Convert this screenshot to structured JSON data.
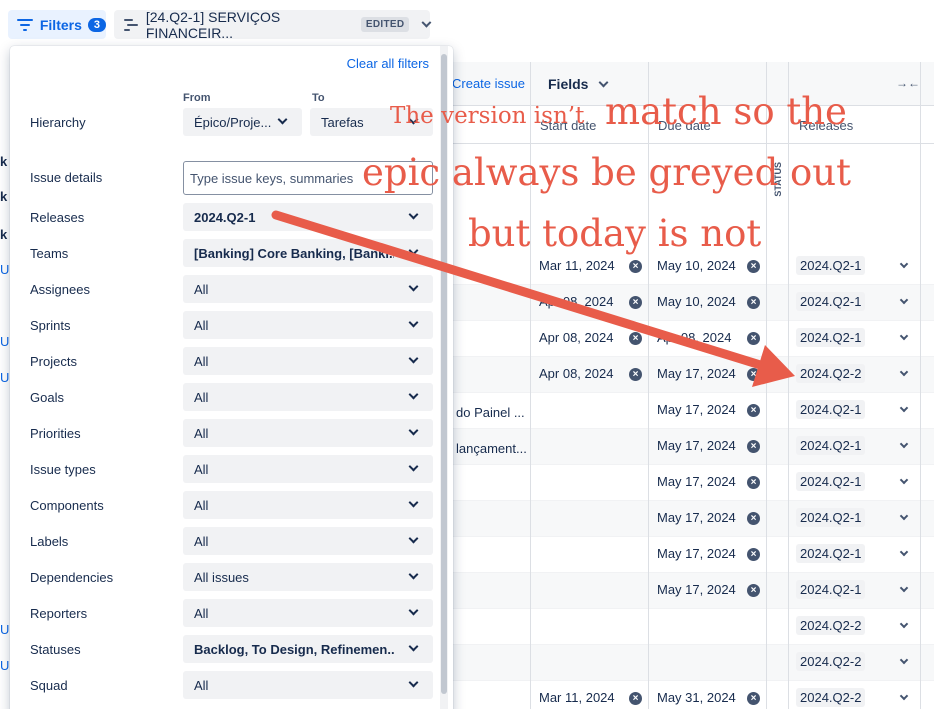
{
  "toolbar": {
    "filters_label": "Filters",
    "filters_count": "3",
    "plan_name": "[24.Q2-1] SERVIÇOS FINANCEIR...",
    "edited_badge": "EDITED"
  },
  "grid": {
    "create_issue": "Create issue",
    "fields_label": "Fields",
    "collapse_icon": "collapse-arrows-icon",
    "columns": {
      "start_date": "Start date",
      "due_date": "Due date",
      "releases": "Releases",
      "status": "STATUS"
    },
    "partial_summaries": [
      "do Painel ...",
      "lançament..."
    ],
    "left_fragments": [
      "k",
      "k",
      "k",
      "U",
      "U",
      "U",
      "U",
      "U"
    ],
    "rows": [
      {
        "start": "Mar 11, 2024",
        "due": "May 10, 2024",
        "release": "2024.Q2-1"
      },
      {
        "start": "Apr 08, 2024",
        "due": "May 10, 2024",
        "release": "2024.Q2-1"
      },
      {
        "start": "Apr 08, 2024",
        "due": "Apr 08, 2024",
        "release": "2024.Q2-1"
      },
      {
        "start": "Apr 08, 2024",
        "due": "May 17, 2024",
        "release": "2024.Q2-2"
      },
      {
        "start": "",
        "due": "May 17, 2024",
        "release": "2024.Q2-1"
      },
      {
        "start": "",
        "due": "May 17, 2024",
        "release": "2024.Q2-1"
      },
      {
        "start": "",
        "due": "May 17, 2024",
        "release": "2024.Q2-1"
      },
      {
        "start": "",
        "due": "May 17, 2024",
        "release": "2024.Q2-1"
      },
      {
        "start": "",
        "due": "May 17, 2024",
        "release": "2024.Q2-1"
      },
      {
        "start": "",
        "due": "May 17, 2024",
        "release": "2024.Q2-1"
      },
      {
        "start": "",
        "due": "",
        "release": "2024.Q2-2"
      },
      {
        "start": "",
        "due": "",
        "release": "2024.Q2-2"
      },
      {
        "start": "Mar 11, 2024",
        "due": "May 31, 2024",
        "release": "2024.Q2-2"
      }
    ]
  },
  "filter_panel": {
    "clear_all": "Clear all filters",
    "from_label": "From",
    "to_label": "To",
    "hierarchy": {
      "label": "Hierarchy",
      "from_value": "Épico/Proje...",
      "to_value": "Tarefas"
    },
    "issue_details": {
      "label": "Issue details",
      "placeholder": "Type issue keys, summaries"
    },
    "filters": [
      {
        "label": "Releases",
        "value": "2024.Q2-1"
      },
      {
        "label": "Teams",
        "value": "[Banking] Core Banking, [Banki..."
      },
      {
        "label": "Assignees",
        "value": "All"
      },
      {
        "label": "Sprints",
        "value": "All"
      },
      {
        "label": "Projects",
        "value": "All"
      },
      {
        "label": "Goals",
        "value": "All"
      },
      {
        "label": "Priorities",
        "value": "All"
      },
      {
        "label": "Issue types",
        "value": "All"
      },
      {
        "label": "Components",
        "value": "All"
      },
      {
        "label": "Labels",
        "value": "All"
      },
      {
        "label": "Dependencies",
        "value": "All issues"
      },
      {
        "label": "Reporters",
        "value": "All"
      },
      {
        "label": "Statuses",
        "value": "Backlog, To Design, Refinemen..."
      },
      {
        "label": "Squad",
        "value": "All"
      }
    ]
  },
  "annotation": {
    "line1a": "The version isn’t ",
    "line1b": "match so the",
    "line2": "epic always be greyed out",
    "line3": "but today is not",
    "color": "#e85c4a"
  }
}
